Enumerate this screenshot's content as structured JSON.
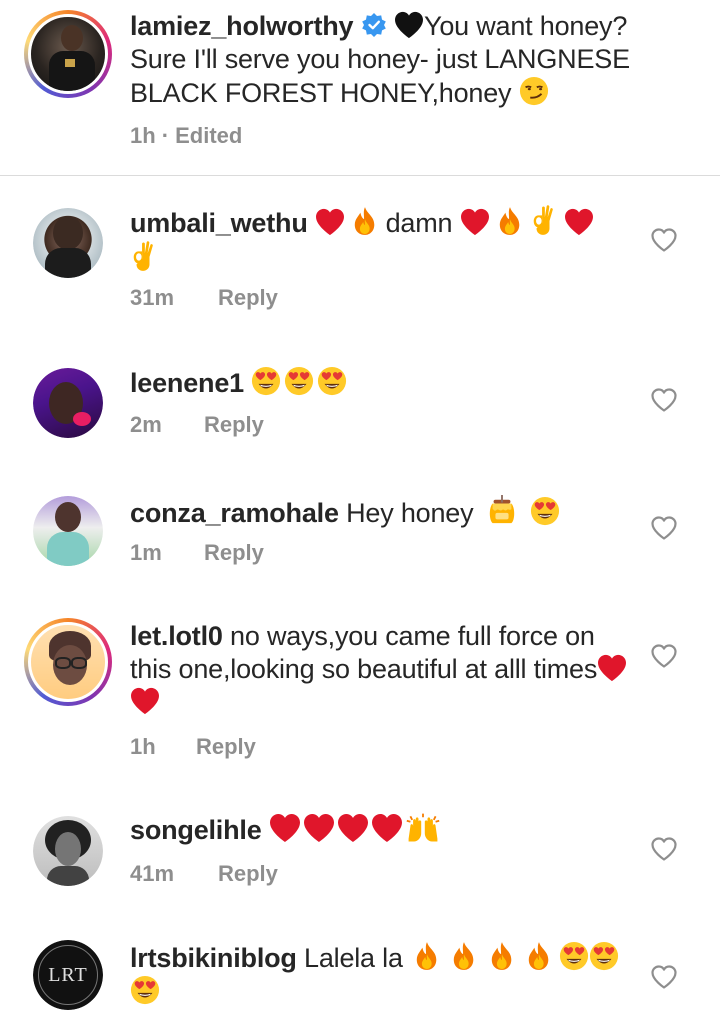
{
  "caption": {
    "username": "lamiez_holworthy",
    "text_line1": "You want honey?",
    "text_rest": "Sure I'll serve you honey- just LANGNESE BLACK FOREST HONEY,honey",
    "time": "1h",
    "edited": "· Edited"
  },
  "reply_label": "Reply",
  "comments": [
    {
      "username": "umbali_wethu",
      "text": "damn",
      "time": "31m"
    },
    {
      "username": "leenene1",
      "text": "",
      "time": "2m"
    },
    {
      "username": "conza_ramohale",
      "text": "Hey honey",
      "time": "1m"
    },
    {
      "username": "let.lotl0",
      "text": "no ways,you came full force on this one,looking so beautiful at alll times",
      "time": "1h"
    },
    {
      "username": "songelihle",
      "text": "",
      "time": "41m"
    },
    {
      "username": "lrtsbikiniblog",
      "text": "Lalela la",
      "time": ""
    }
  ],
  "lrt_logo_text": "LRT",
  "colors": {
    "heart": "#e0162b",
    "fire": "#f57c00",
    "verified": "#3897f0",
    "muted": "#8e8e8e"
  }
}
